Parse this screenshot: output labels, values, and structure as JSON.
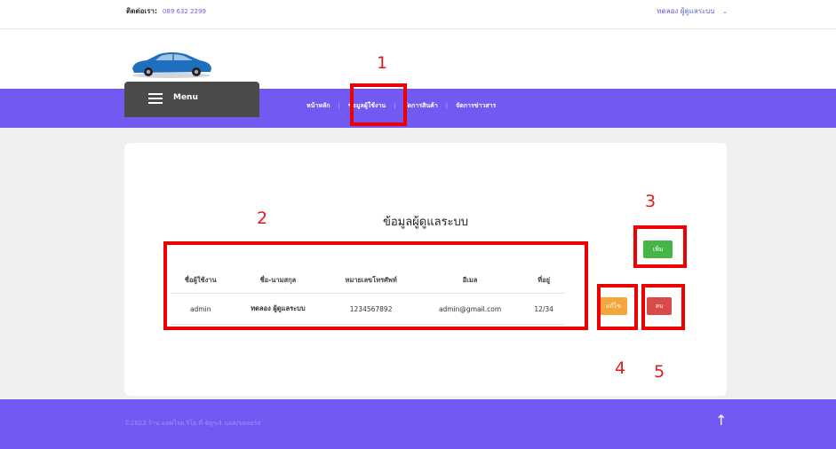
{
  "header": {
    "contact_label": "ติดต่อเรา:",
    "contact_phone": "089 632 2299",
    "user_name": "ทดลอง ผู้ดูแลระบบ",
    "user_chevron_icon": "chevron-down-icon"
  },
  "brand": {
    "logo_icon": "car-logo"
  },
  "menu": {
    "label": "Menu",
    "icon": "hamburger-icon"
  },
  "nav": {
    "items": [
      {
        "label": "หน้าหลัก"
      },
      {
        "label": "ข้อมูลผู้ใช้งาน"
      },
      {
        "label": "จัดการสินค้า"
      },
      {
        "label": "จัดการข่าวสาร"
      }
    ]
  },
  "main": {
    "title": "ข้อมูลผู้ดูแลระบบ",
    "add_label": "เพิ่ม",
    "table": {
      "headers": [
        "ชื่อผู้ใช้งาน",
        "ชื่อ-นามสกุล",
        "หมายเลขโทรศัพท์",
        "อีเมล",
        "ที่อยู่"
      ],
      "rows": [
        [
          "admin",
          "ทดลอง ผู้ดูแลระบบ",
          "1234567892",
          "admin@gmail.com",
          "12/34"
        ]
      ]
    },
    "edit_label": "แก้ไข",
    "delete_label": "ลบ"
  },
  "footer": {
    "copyright": "©2022 ร้าน ออฟโรด ริโอ ที่ 4ลูกเ4 นอค/ขลอยร์ส",
    "up_icon": "arrow-up-icon"
  },
  "annotations": [
    "1",
    "2",
    "3",
    "4",
    "5"
  ],
  "colors": {
    "nav_bg": "#7159f2",
    "menu_bg": "#4a4a4a",
    "add": "#45b645",
    "edit": "#f4a63a",
    "delete": "#d94b48",
    "highlight": "#ee0000"
  }
}
